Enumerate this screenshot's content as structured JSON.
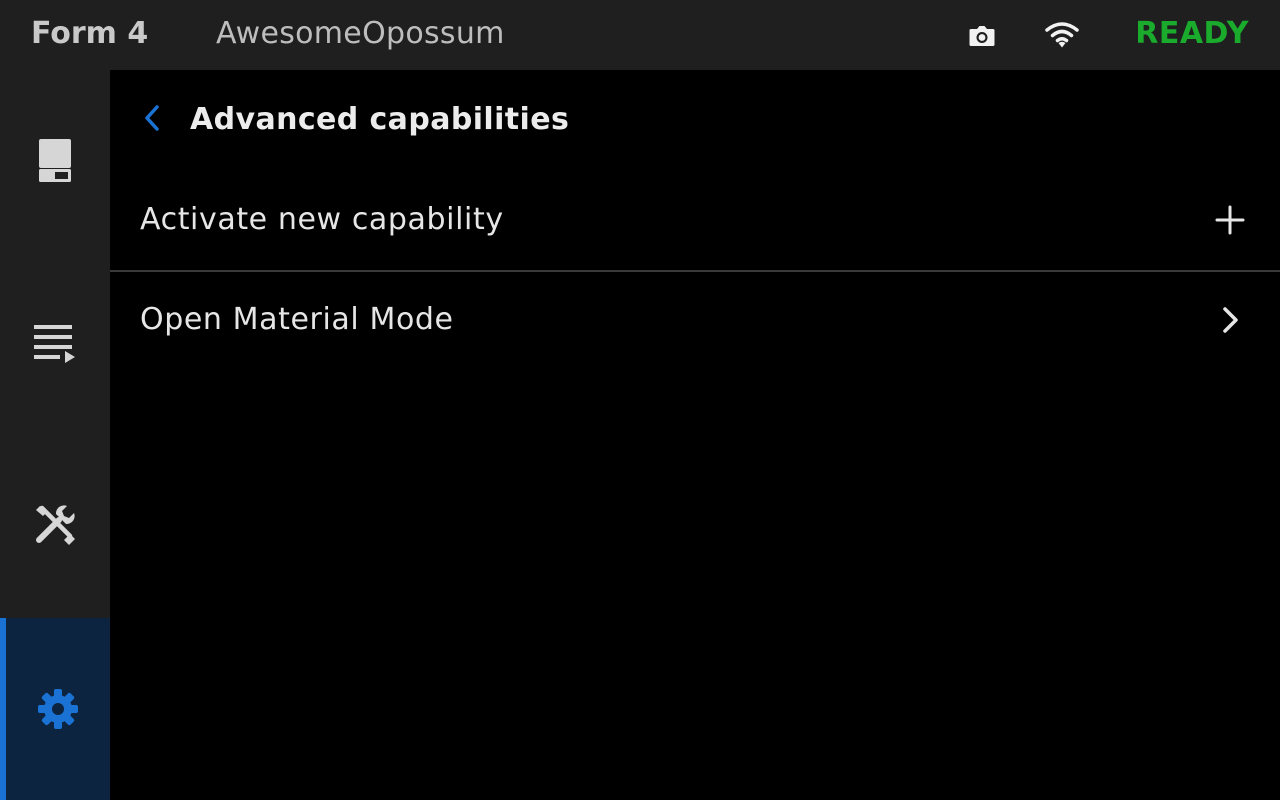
{
  "header": {
    "model": "Form 4",
    "printer_name": "AwesomeOpossum",
    "status": "READY",
    "icons": [
      "camera-icon",
      "wifi-icon"
    ]
  },
  "colors": {
    "ready": "#1aab2d",
    "accent": "#1a73d4",
    "topbar_bg": "#1f1f1f",
    "main_bg": "#000000",
    "active_nav_bg": "#0c2440"
  },
  "sidebar": {
    "items": [
      {
        "icon": "printer-icon",
        "active": false
      },
      {
        "icon": "print-queue-icon",
        "active": false
      },
      {
        "icon": "tools-icon",
        "active": false
      },
      {
        "icon": "settings-gear-icon",
        "active": true
      }
    ]
  },
  "main": {
    "title": "Advanced capabilities",
    "rows": [
      {
        "label": "Activate new capability",
        "icon": "plus-icon"
      },
      {
        "label": "Open Material Mode",
        "icon": "chevron-right-icon"
      }
    ]
  }
}
